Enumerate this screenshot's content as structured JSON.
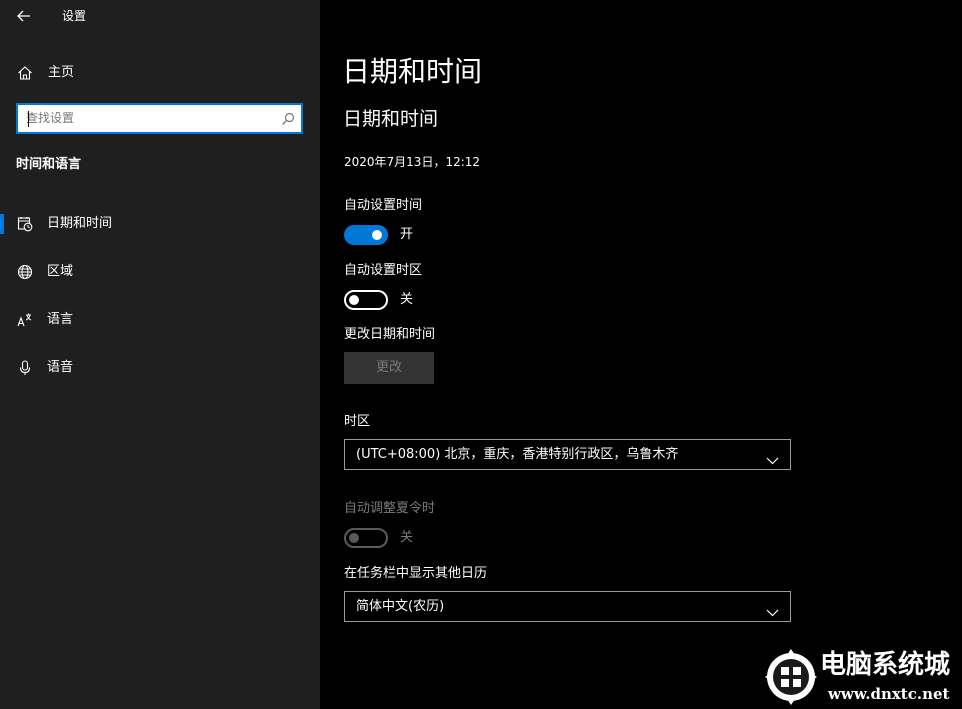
{
  "window": {
    "title": "设置"
  },
  "sidebar": {
    "home_label": "主页",
    "search_placeholder": "查找设置",
    "section_heading": "时间和语言",
    "items": [
      {
        "label": "日期和时间",
        "icon": "calendar-clock-icon",
        "selected": true
      },
      {
        "label": "区域",
        "icon": "globe-icon",
        "selected": false
      },
      {
        "label": "语言",
        "icon": "language-icon",
        "selected": false
      },
      {
        "label": "语音",
        "icon": "microphone-icon",
        "selected": false
      }
    ]
  },
  "main": {
    "page_title": "日期和时间",
    "section_title": "日期和时间",
    "current_datetime": "2020年7月13日，12:12",
    "auto_time": {
      "label": "自动设置时间",
      "state": "开",
      "on": true
    },
    "auto_timezone": {
      "label": "自动设置时区",
      "state": "关",
      "on": false
    },
    "change_datetime": {
      "label": "更改日期和时间",
      "button": "更改"
    },
    "timezone": {
      "label": "时区",
      "value": "(UTC+08:00) 北京，重庆，香港特别行政区，乌鲁木齐"
    },
    "dst": {
      "label": "自动调整夏令时",
      "state": "关",
      "on": false,
      "disabled": true
    },
    "extra_calendar": {
      "label": "在任务栏中显示其他日历",
      "value": "简体中文(农历)"
    }
  },
  "watermark": {
    "title": "电脑系统城",
    "url": "www.dnxtc.net"
  },
  "colors": {
    "accent": "#0078d7",
    "sidebar_bg": "#1f1f1f",
    "main_bg": "#000000",
    "disabled_text": "#7a7a7a"
  }
}
